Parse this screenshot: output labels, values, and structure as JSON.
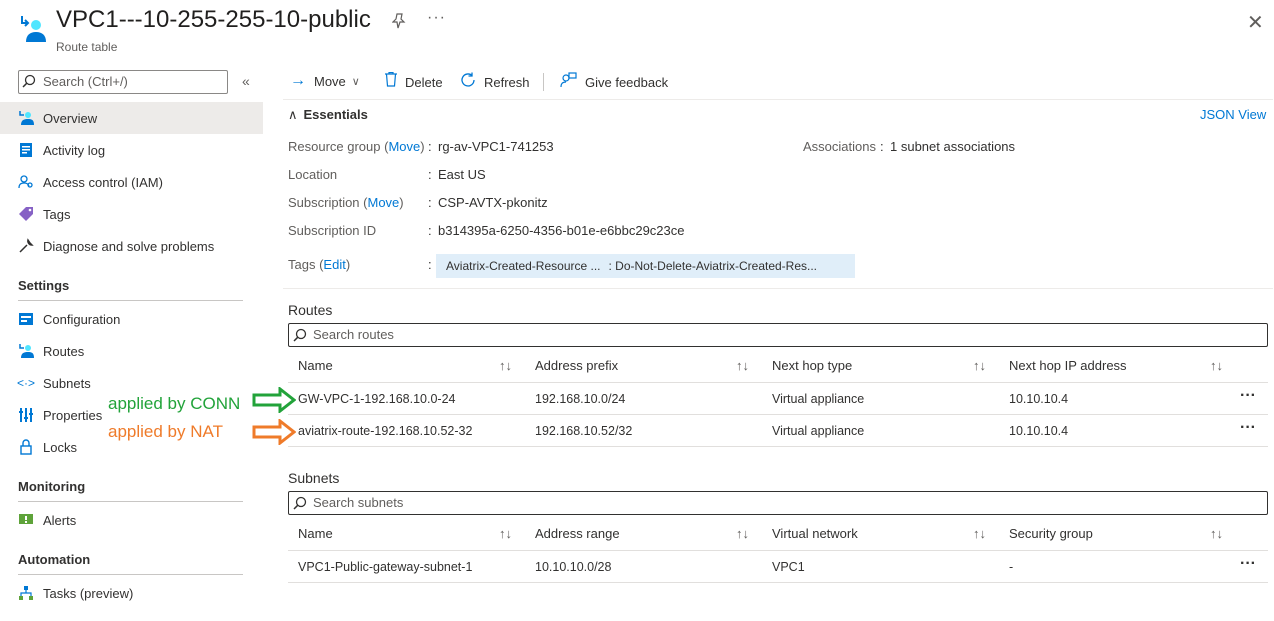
{
  "header": {
    "title": "VPC1---10-255-255-10-public",
    "subtitle": "Route table",
    "icon": "route-table-icon",
    "pin_icon": "pin-icon",
    "more_label": "···",
    "close_label": "✕"
  },
  "sidebar": {
    "search_placeholder": "Search (Ctrl+/)",
    "collapse_label": "«",
    "items_top": [
      {
        "label": "Overview",
        "icon": "overview-icon",
        "active": true
      },
      {
        "label": "Activity log",
        "icon": "activity-log-icon"
      },
      {
        "label": "Access control (IAM)",
        "icon": "iam-icon"
      },
      {
        "label": "Tags",
        "icon": "tag-icon"
      },
      {
        "label": "Diagnose and solve problems",
        "icon": "wrench-icon"
      }
    ],
    "section_settings": "Settings",
    "items_settings": [
      {
        "label": "Configuration",
        "icon": "configuration-icon"
      },
      {
        "label": "Routes",
        "icon": "routes-icon"
      },
      {
        "label": "Subnets",
        "icon": "subnets-icon"
      },
      {
        "label": "Properties",
        "icon": "properties-icon"
      },
      {
        "label": "Locks",
        "icon": "lock-icon"
      }
    ],
    "section_monitoring": "Monitoring",
    "items_monitoring": [
      {
        "label": "Alerts",
        "icon": "alerts-icon"
      }
    ],
    "section_automation": "Automation",
    "items_automation": [
      {
        "label": "Tasks (preview)",
        "icon": "tasks-icon"
      }
    ]
  },
  "toolbar": {
    "move": "Move",
    "delete": "Delete",
    "refresh": "Refresh",
    "feedback": "Give feedback"
  },
  "essentials": {
    "title": "Essentials",
    "json_view": "JSON View",
    "resource_group_label": "Resource group",
    "move_link": "Move",
    "resource_group_value": "rg-av-VPC1-741253",
    "location_label": "Location",
    "location_value": "East US",
    "subscription_label": "Subscription",
    "subscription_value": "CSP-AVTX-pkonitz",
    "subscription_id_label": "Subscription ID",
    "subscription_id_value": "b314395a-6250-4356-b01e-e6bbc29c23ce",
    "tags_label": "Tags",
    "edit_link": "Edit",
    "tag_key": "Aviatrix-Created-Resource ...",
    "tag_value": ": Do-Not-Delete-Aviatrix-Created-Res...",
    "associations_label": "Associations",
    "associations_value": "1 subnet associations",
    "colon": ":"
  },
  "routes": {
    "title": "Routes",
    "search_placeholder": "Search routes",
    "columns": [
      "Name",
      "Address prefix",
      "Next hop type",
      "Next hop IP address"
    ],
    "rows": [
      [
        "GW-VPC-1-192.168.10.0-24",
        "192.168.10.0/24",
        "Virtual appliance",
        "10.10.10.4"
      ],
      [
        "aviatrix-route-192.168.10.52-32",
        "192.168.10.52/32",
        "Virtual appliance",
        "10.10.10.4"
      ]
    ]
  },
  "subnets": {
    "title": "Subnets",
    "search_placeholder": "Search subnets",
    "columns": [
      "Name",
      "Address range",
      "Virtual network",
      "Security group"
    ],
    "rows": [
      [
        "VPC1-Public-gateway-subnet-1",
        "10.10.10.0/28",
        "VPC1",
        "-"
      ]
    ]
  },
  "annotations": {
    "conn": "applied by CONN",
    "nat": "applied by NAT",
    "conn_color": "#22a33a",
    "nat_color": "#ef7b2a"
  },
  "row_more": "···",
  "sort_glyph": "↑↓"
}
